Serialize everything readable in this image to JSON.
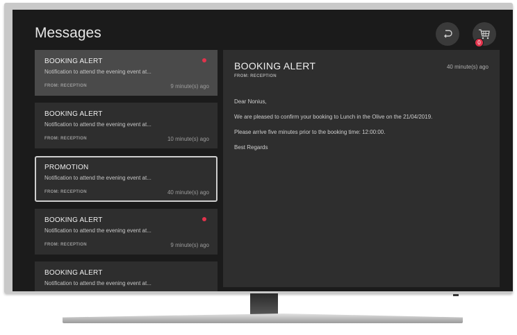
{
  "header": {
    "title": "Messages"
  },
  "toolbar": {
    "back_icon": "back-arrow-icon",
    "cart_icon": "cart-icon",
    "cart_badge": "0"
  },
  "colors": {
    "screen_bg": "#1b1b1b",
    "card_bg": "#2e2e2e",
    "active_card_bg": "#4a4a4a",
    "unread_dot": "#e2334c"
  },
  "messages": [
    {
      "title": "BOOKING ALERT",
      "snippet": "Notification to attend the evening event at...",
      "from": "FROM: RECEPTION",
      "time": "9 minute(s) ago",
      "unread": true,
      "state": "selected"
    },
    {
      "title": "BOOKING ALERT",
      "snippet": "Notification to attend the evening event at...",
      "from": "FROM: RECEPTION",
      "time": "10 minute(s) ago",
      "unread": false,
      "state": "normal"
    },
    {
      "title": "PROMOTION",
      "snippet": "Notification to attend the evening event at...",
      "from": "FROM: RECEPTION",
      "time": "40 minute(s) ago",
      "unread": false,
      "state": "focused"
    },
    {
      "title": "BOOKING ALERT",
      "snippet": "Notification to attend the evening event at...",
      "from": "FROM: RECEPTION",
      "time": "9 minute(s) ago",
      "unread": true,
      "state": "normal"
    },
    {
      "title": "BOOKING ALERT",
      "snippet": "Notification to attend the evening event at...",
      "from": "",
      "time": "",
      "unread": false,
      "state": "normal"
    }
  ],
  "detail": {
    "title": "BOOKING ALERT",
    "from": "FROM: RECEPTION",
    "time": "40 minute(s) ago",
    "body": [
      "Dear Nonius,",
      "We are pleased to confirm your booking to Lunch in the Olive on the 21/04/2019.",
      "Please arrive five minutes prior to the booking time: 12:00:00.",
      "Best Regards"
    ]
  }
}
